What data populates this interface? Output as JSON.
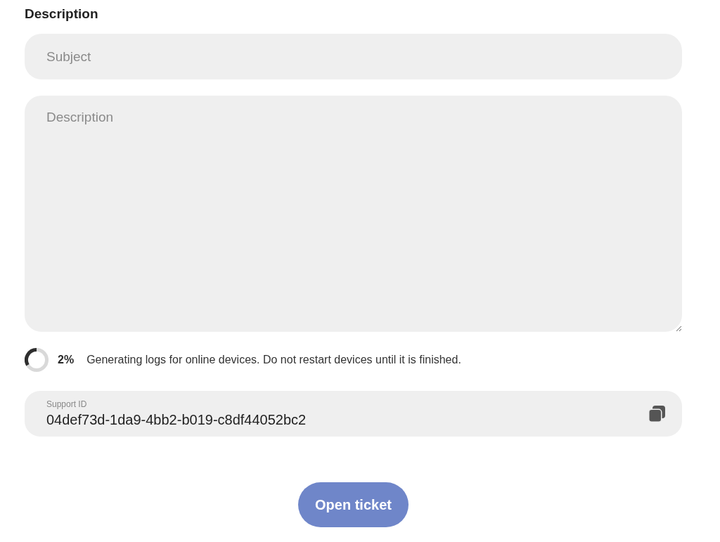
{
  "heading": "Description",
  "subject_field": {
    "placeholder": "Subject"
  },
  "description_field": {
    "placeholder": "Description"
  },
  "log_progress": {
    "percent": "2%",
    "message": "Generating logs for online devices. Do not restart devices until it is finished."
  },
  "support_id": {
    "label": "Support ID",
    "value": "04def73d-1da9-4bb2-b019-c8df44052bc2"
  },
  "buttons": [
    {
      "label": "Open ticket"
    }
  ]
}
